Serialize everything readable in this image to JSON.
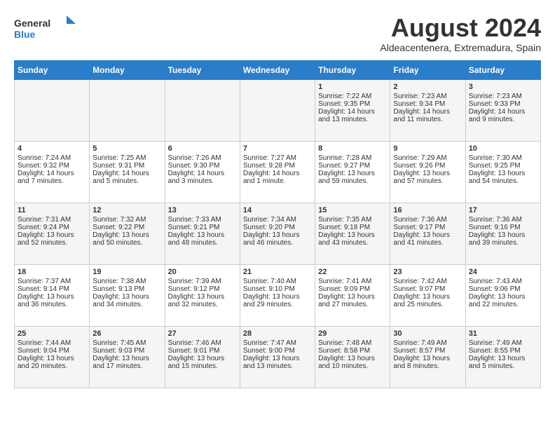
{
  "header": {
    "logo_line1": "General",
    "logo_line2": "Blue",
    "month_year": "August 2024",
    "location": "Aldeacentenera, Extremadura, Spain"
  },
  "days_of_week": [
    "Sunday",
    "Monday",
    "Tuesday",
    "Wednesday",
    "Thursday",
    "Friday",
    "Saturday"
  ],
  "weeks": [
    [
      {
        "day": "",
        "content": ""
      },
      {
        "day": "",
        "content": ""
      },
      {
        "day": "",
        "content": ""
      },
      {
        "day": "",
        "content": ""
      },
      {
        "day": "1",
        "content": "Sunrise: 7:22 AM\nSunset: 9:35 PM\nDaylight: 14 hours\nand 13 minutes."
      },
      {
        "day": "2",
        "content": "Sunrise: 7:23 AM\nSunset: 9:34 PM\nDaylight: 14 hours\nand 11 minutes."
      },
      {
        "day": "3",
        "content": "Sunrise: 7:23 AM\nSunset: 9:33 PM\nDaylight: 14 hours\nand 9 minutes."
      }
    ],
    [
      {
        "day": "4",
        "content": "Sunrise: 7:24 AM\nSunset: 9:32 PM\nDaylight: 14 hours\nand 7 minutes."
      },
      {
        "day": "5",
        "content": "Sunrise: 7:25 AM\nSunset: 9:31 PM\nDaylight: 14 hours\nand 5 minutes."
      },
      {
        "day": "6",
        "content": "Sunrise: 7:26 AM\nSunset: 9:30 PM\nDaylight: 14 hours\nand 3 minutes."
      },
      {
        "day": "7",
        "content": "Sunrise: 7:27 AM\nSunset: 9:28 PM\nDaylight: 14 hours\nand 1 minute."
      },
      {
        "day": "8",
        "content": "Sunrise: 7:28 AM\nSunset: 9:27 PM\nDaylight: 13 hours\nand 59 minutes."
      },
      {
        "day": "9",
        "content": "Sunrise: 7:29 AM\nSunset: 9:26 PM\nDaylight: 13 hours\nand 57 minutes."
      },
      {
        "day": "10",
        "content": "Sunrise: 7:30 AM\nSunset: 9:25 PM\nDaylight: 13 hours\nand 54 minutes."
      }
    ],
    [
      {
        "day": "11",
        "content": "Sunrise: 7:31 AM\nSunset: 9:24 PM\nDaylight: 13 hours\nand 52 minutes."
      },
      {
        "day": "12",
        "content": "Sunrise: 7:32 AM\nSunset: 9:22 PM\nDaylight: 13 hours\nand 50 minutes."
      },
      {
        "day": "13",
        "content": "Sunrise: 7:33 AM\nSunset: 9:21 PM\nDaylight: 13 hours\nand 48 minutes."
      },
      {
        "day": "14",
        "content": "Sunrise: 7:34 AM\nSunset: 9:20 PM\nDaylight: 13 hours\nand 46 minutes."
      },
      {
        "day": "15",
        "content": "Sunrise: 7:35 AM\nSunset: 9:18 PM\nDaylight: 13 hours\nand 43 minutes."
      },
      {
        "day": "16",
        "content": "Sunrise: 7:36 AM\nSunset: 9:17 PM\nDaylight: 13 hours\nand 41 minutes."
      },
      {
        "day": "17",
        "content": "Sunrise: 7:36 AM\nSunset: 9:16 PM\nDaylight: 13 hours\nand 39 minutes."
      }
    ],
    [
      {
        "day": "18",
        "content": "Sunrise: 7:37 AM\nSunset: 9:14 PM\nDaylight: 13 hours\nand 36 minutes."
      },
      {
        "day": "19",
        "content": "Sunrise: 7:38 AM\nSunset: 9:13 PM\nDaylight: 13 hours\nand 34 minutes."
      },
      {
        "day": "20",
        "content": "Sunrise: 7:39 AM\nSunset: 9:12 PM\nDaylight: 13 hours\nand 32 minutes."
      },
      {
        "day": "21",
        "content": "Sunrise: 7:40 AM\nSunset: 9:10 PM\nDaylight: 13 hours\nand 29 minutes."
      },
      {
        "day": "22",
        "content": "Sunrise: 7:41 AM\nSunset: 9:09 PM\nDaylight: 13 hours\nand 27 minutes."
      },
      {
        "day": "23",
        "content": "Sunrise: 7:42 AM\nSunset: 9:07 PM\nDaylight: 13 hours\nand 25 minutes."
      },
      {
        "day": "24",
        "content": "Sunrise: 7:43 AM\nSunset: 9:06 PM\nDaylight: 13 hours\nand 22 minutes."
      }
    ],
    [
      {
        "day": "25",
        "content": "Sunrise: 7:44 AM\nSunset: 9:04 PM\nDaylight: 13 hours\nand 20 minutes."
      },
      {
        "day": "26",
        "content": "Sunrise: 7:45 AM\nSunset: 9:03 PM\nDaylight: 13 hours\nand 17 minutes."
      },
      {
        "day": "27",
        "content": "Sunrise: 7:46 AM\nSunset: 9:01 PM\nDaylight: 13 hours\nand 15 minutes."
      },
      {
        "day": "28",
        "content": "Sunrise: 7:47 AM\nSunset: 9:00 PM\nDaylight: 13 hours\nand 13 minutes."
      },
      {
        "day": "29",
        "content": "Sunrise: 7:48 AM\nSunset: 8:58 PM\nDaylight: 13 hours\nand 10 minutes."
      },
      {
        "day": "30",
        "content": "Sunrise: 7:49 AM\nSunset: 8:57 PM\nDaylight: 13 hours\nand 8 minutes."
      },
      {
        "day": "31",
        "content": "Sunrise: 7:49 AM\nSunset: 8:55 PM\nDaylight: 13 hours\nand 5 minutes."
      }
    ]
  ]
}
